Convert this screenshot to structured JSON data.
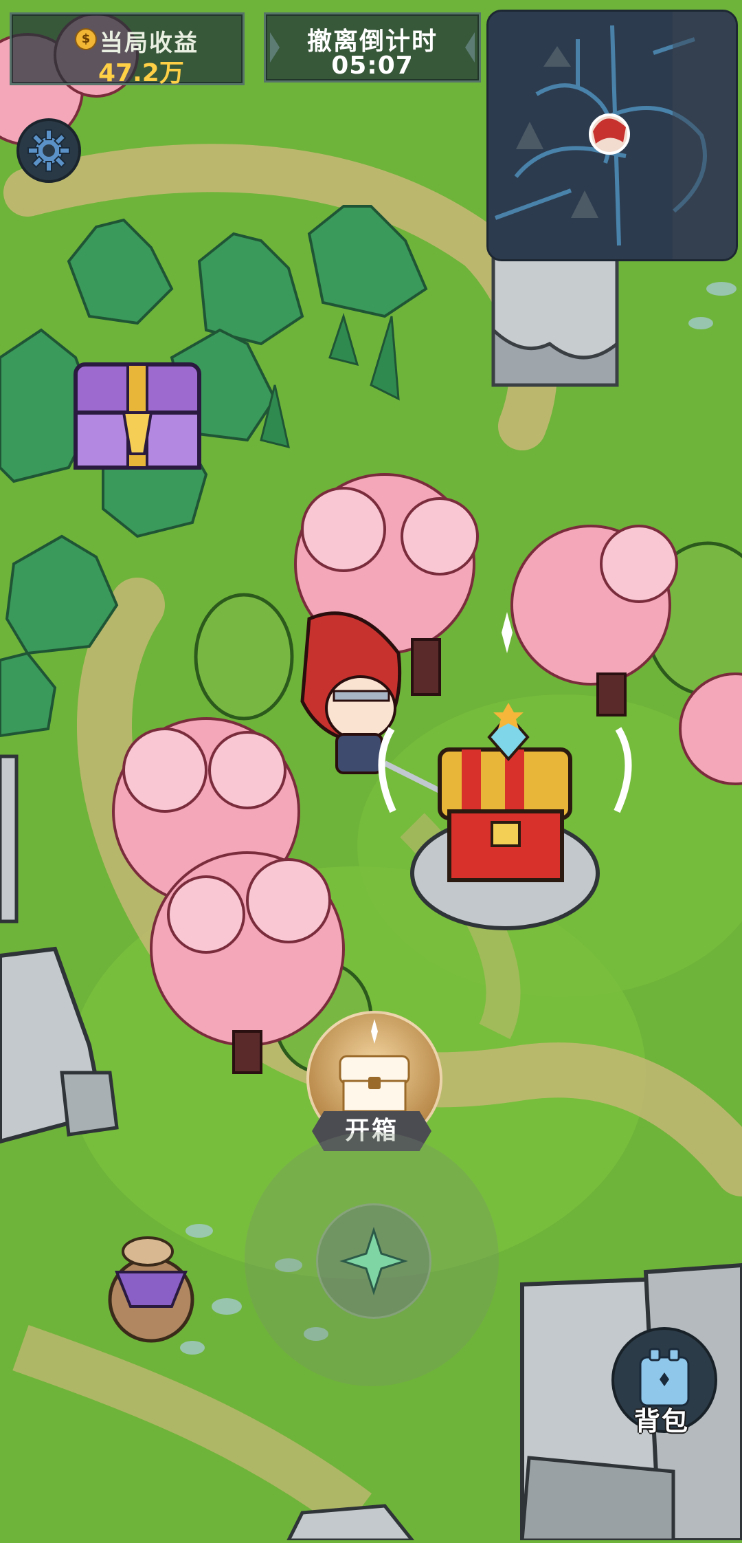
{
  "hud": {
    "earnings_label": "当局收益",
    "earnings_value": "47.2万",
    "coin_symbol": "$",
    "countdown_label": "撤离倒计时",
    "countdown_value": "05:07"
  },
  "actions": {
    "open_chest_label": "开箱",
    "backpack_label": "背包"
  },
  "icons": {
    "settings": "gear-icon",
    "minimap_player": "player-avatar-icon",
    "open_chest": "chest-icon",
    "backpack": "backpack-icon",
    "joystick": "star-compass-icon"
  },
  "colors": {
    "grass": "#6fb43a",
    "path": "#c8b777",
    "blossom": "#f3a7b8",
    "gold_text": "#ffd046",
    "hud_bg": "#22343a"
  }
}
